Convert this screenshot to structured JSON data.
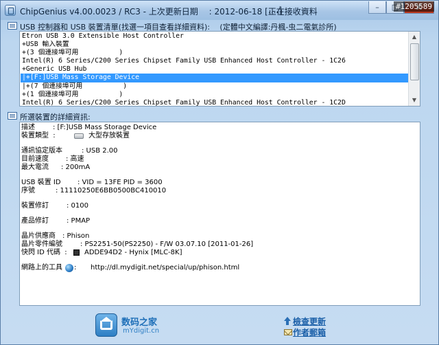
{
  "window": {
    "title": "ChipGenius v4.00.0023 / RC3 - 上次更新日期　 : 2012-06-18 [正在接收資料",
    "title_tail": "....]",
    "watermark": "#1205589",
    "buttons": {
      "minimize": "–",
      "maximize": "□",
      "close": "X"
    }
  },
  "device_list": {
    "header": "USB 控制器和 USB 裝置清單(找選一項目查看詳細資料):　 (定體中文編譯:丹楓-虫二電氣診所)",
    "rows": [
      "Etron USB 3.0 Extensible Host Controller",
      "+USB 輸入裝置",
      "+(3 個連接埠可用          )",
      "Intel(R) 6 Series/C200 Series Chipset Family USB Enhanced Host Controller - 1C26",
      "+Generic USB Hub",
      "|+[F:]USB Mass Storage Device",
      "|+(7 個連接埠可用          )",
      "+(1 個連接埠可用          )",
      "Intel(R) 6 Series/C200 Series Chipset Family USB Enhanced Host Controller - 1C2D"
    ],
    "selected_index": 5
  },
  "details": {
    "header": "所選裝置的詳細資訊:",
    "description_label": "描述",
    "description": ": [F:]USB Mass Storage Device",
    "device_type_label": "裝置類型",
    "device_type": "大型存放裝置",
    "protocol_label": "通訊協定版本",
    "protocol": ": USB 2.00",
    "speed_label": "目前速度",
    "speed": ": 高速",
    "max_current_label": "最大電流",
    "max_current": ": 200mA",
    "usb_id_label": "USB 裝置 ID",
    "usb_id": ": VID = 13FE PID = 3600",
    "serial_label": "序號",
    "serial": ": 11110250E6BB0500BC410010",
    "device_rev_label": "裝置修訂",
    "device_rev": ": 0100",
    "product_rev_label": "產品修訂",
    "product_rev": ": PMAP",
    "chip_vendor_label": "晶片供應商",
    "chip_vendor": ": Phison",
    "chip_part_label": "晶片零件編號",
    "chip_part": ": PS2251-50(PS2250) - F/W 03.07.10 [2011-01-26]",
    "flash_id_label": "快閃 ID 代碼",
    "flash_id": "ADDE94D2 - Hynix [MLC-8K]",
    "online_tools_label": "網路上的工具",
    "online_tools_url": "http://dl.mydigit.net/special/up/phison.html"
  },
  "footer": {
    "logo_cn": "数码之家",
    "logo_en": "mYdigit.cn",
    "check_update": "檢查更新",
    "author_email": "作者郵箱"
  }
}
